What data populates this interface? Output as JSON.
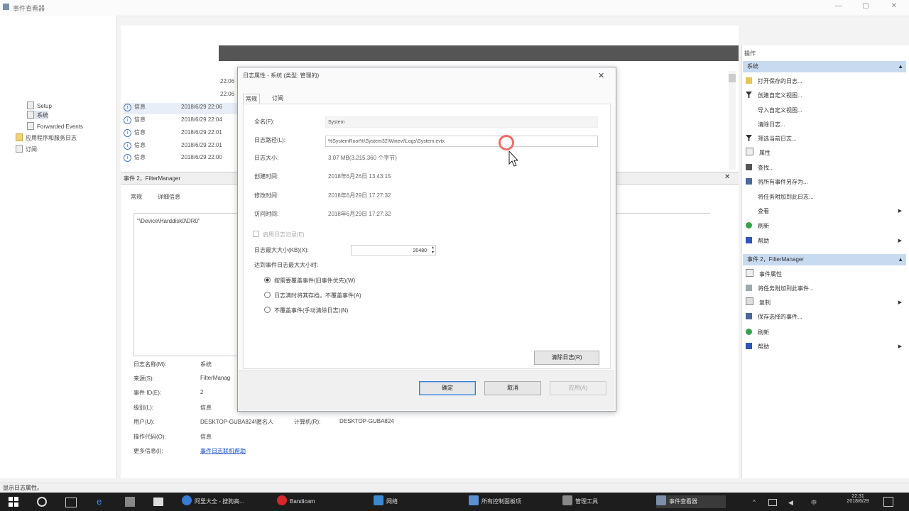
{
  "window": {
    "title": "事件查看器"
  },
  "left_tree": [
    {
      "label": "Setup"
    },
    {
      "label": "系统"
    },
    {
      "label": "Forwarded Events"
    },
    {
      "label": "应用程序和服务日志"
    },
    {
      "label": "订阅"
    }
  ],
  "events": {
    "rows": [
      {
        "time": "22:06"
      },
      {
        "time": "22:06"
      },
      {
        "level": "信息",
        "date": "2018/6/29 22:06"
      },
      {
        "level": "信息",
        "date": "2018/6/29 22:04"
      },
      {
        "level": "信息",
        "date": "2018/6/29 22:01"
      },
      {
        "level": "信息",
        "date": "2018/6/29 22:01"
      },
      {
        "level": "信息",
        "date": "2018/6/29 22:00"
      }
    ]
  },
  "detail": {
    "title": "事件 2，FilterManager",
    "tabs": [
      "常规",
      "详细信息"
    ],
    "message": "\"\\Device\\Harddisk0\\DR0\"",
    "props": [
      {
        "label": "日志名称(M):",
        "value": "系统"
      },
      {
        "label": "来源(S):",
        "value": "FilterManag"
      },
      {
        "label": "事件 ID(E):",
        "value": "2"
      },
      {
        "label": "级别(L):",
        "value": "信息"
      },
      {
        "label": "用户(U):",
        "value": "DESKTOP-GUBA824\\匿名人",
        "extra_label": "计算机(R):",
        "extra_value": "DESKTOP-GUBA824"
      },
      {
        "label": "操作代码(O):",
        "value": "信息"
      },
      {
        "label": "更多信息(I):",
        "value": "事件日志联机帮助"
      }
    ]
  },
  "actions": {
    "header": "操作",
    "section1": {
      "title": "系统",
      "items": [
        {
          "label": "打开保存的日志...",
          "icon": "folder-icon"
        },
        {
          "label": "创建自定义视图...",
          "icon": "filter-icon"
        },
        {
          "label": "导入自定义视图...",
          "icon": "blank"
        },
        {
          "label": "清除日志...",
          "icon": "blank"
        },
        {
          "label": "筛选当前日志...",
          "icon": "filter-icon"
        },
        {
          "label": "属性",
          "icon": "properties-icon"
        },
        {
          "label": "查找...",
          "icon": "find-icon"
        },
        {
          "label": "将所有事件另存为...",
          "icon": "save-icon"
        },
        {
          "label": "将任务附加到此日志...",
          "icon": "blank"
        },
        {
          "label": "查看",
          "icon": "blank",
          "submenu": true
        },
        {
          "label": "刷新",
          "icon": "refresh-icon"
        },
        {
          "label": "帮助",
          "icon": "help-icon",
          "submenu": true
        }
      ]
    },
    "section2": {
      "title": "事件 2，FilterManager",
      "items": [
        {
          "label": "事件属性",
          "icon": "properties-icon"
        },
        {
          "label": "将任务附加到此事件...",
          "icon": "task-icon"
        },
        {
          "label": "复制",
          "icon": "copy-icon",
          "submenu": true
        },
        {
          "label": "保存选择的事件...",
          "icon": "save-icon"
        },
        {
          "label": "刷新",
          "icon": "refresh-icon"
        },
        {
          "label": "帮助",
          "icon": "help-icon",
          "submenu": true
        }
      ]
    }
  },
  "dialog": {
    "title": "日志属性 - 系统 (类型: 管理的)",
    "tabs": [
      "常规",
      "订阅"
    ],
    "full_name_label": "全名(F):",
    "full_name": "System",
    "log_path_label": "日志路径(L):",
    "log_path": "%SystemRoot%\\System32\\Winevt\\Logs\\System.evtx",
    "log_size_label": "日志大小:",
    "log_size": "3.07 MB(3,215,360 个字节)",
    "created_label": "创建时间:",
    "created": "2018年6月26日 13:43:15",
    "modified_label": "修改时间:",
    "modified": "2018年6月29日 17:27:32",
    "accessed_label": "访问时间:",
    "accessed": "2018年6月29日 17:27:32",
    "enable_logging_label": "启用日志记录(E)",
    "max_size_label": "日志最大大小(KB)(X):",
    "max_size": "20480",
    "when_max_label": "达到事件日志最大大小时:",
    "options": [
      {
        "label": "按需要覆盖事件(旧事件优先)(W)",
        "selected": true
      },
      {
        "label": "日志满时将其存档，不覆盖事件(A)",
        "selected": false
      },
      {
        "label": "不覆盖事件(手动清除日志)(N)",
        "selected": false
      }
    ],
    "clear_button": "清除日志(R)",
    "ok_button": "确定",
    "cancel_button": "取消",
    "apply_button": "应用(A)"
  },
  "statusbar": {
    "text": "显示日志属性。"
  },
  "taskbar": {
    "items": [
      {
        "label": "阿里大全 - 搜狗高..."
      },
      {
        "label": "Bandicam"
      },
      {
        "label": "网络"
      },
      {
        "label": "所有控制面板项"
      },
      {
        "label": "管理工具"
      },
      {
        "label": "事件查看器"
      }
    ],
    "clock_time": "22:31",
    "clock_date": "2018/6/29"
  },
  "colors": {
    "accent": "#3b7bd0",
    "selection": "#c8daf0",
    "taskbar": "#1d1d1d"
  }
}
